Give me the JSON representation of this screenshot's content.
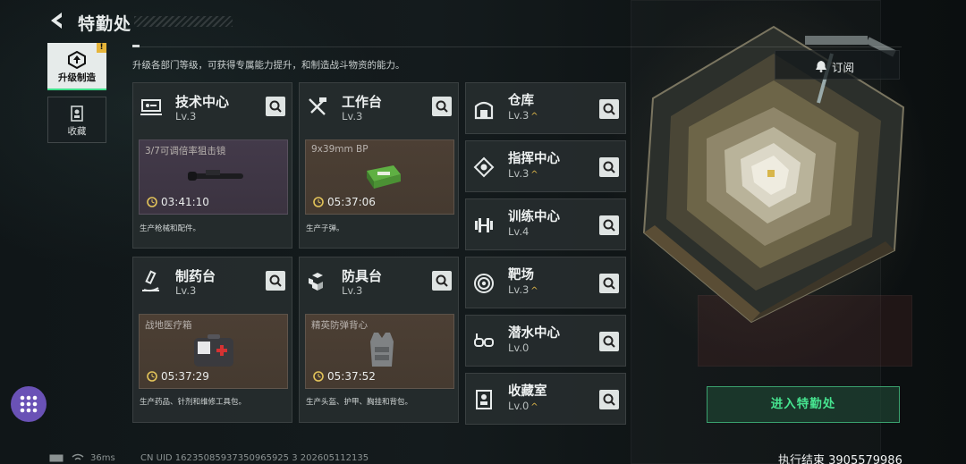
{
  "header": {
    "title": "特勤处"
  },
  "description": "升级各部门等级，可获得专属能力提升，和制造战斗物资的能力。",
  "nav": [
    {
      "label": "升级制造",
      "icon": "upgrade-icon",
      "badge": "!"
    },
    {
      "label": "收藏",
      "icon": "collection-icon"
    }
  ],
  "cards": [
    {
      "name": "技术中心",
      "level": "Lv.3",
      "icon": "tech-center-icon",
      "slot_title": "3/7可调倍率狙击镜",
      "timer": "03:41:10",
      "footer": "生产枪械和配件。",
      "item_icon": "scope-icon"
    },
    {
      "name": "工作台",
      "level": "Lv.3",
      "icon": "workbench-icon",
      "slot_title": "9x39mm BP",
      "timer": "05:37:06",
      "footer": "生产子弹。",
      "item_icon": "ammo-box-icon"
    },
    {
      "name": "制药台",
      "level": "Lv.3",
      "icon": "pharmacy-icon",
      "slot_title": "战地医疗箱",
      "timer": "05:37:29",
      "footer": "生产药品、针剂和维修工具包。",
      "item_icon": "medkit-icon"
    },
    {
      "name": "防具台",
      "level": "Lv.3",
      "icon": "armor-bench-icon",
      "slot_title": "精英防弹背心",
      "timer": "05:37:52",
      "footer": "生产头盔、护甲、胸挂和背包。",
      "item_icon": "vest-icon"
    }
  ],
  "departments": [
    {
      "name": "仓库",
      "level": "Lv.3",
      "upgradable": true,
      "icon": "warehouse-icon"
    },
    {
      "name": "指挥中心",
      "level": "Lv.3",
      "upgradable": true,
      "icon": "command-center-icon"
    },
    {
      "name": "训练中心",
      "level": "Lv.4",
      "upgradable": false,
      "icon": "dumbbell-icon"
    },
    {
      "name": "靶场",
      "level": "Lv.3",
      "upgradable": true,
      "icon": "target-icon"
    },
    {
      "name": "潜水中心",
      "level": "Lv.0",
      "upgradable": false,
      "icon": "diving-mask-icon"
    },
    {
      "name": "收藏室",
      "level": "Lv.0",
      "upgradable": true,
      "icon": "collection-room-icon"
    }
  ],
  "upgrade_mark": "^",
  "subscribe_label": "订阅",
  "enter_label": "进入特勤处",
  "status": {
    "ping": "36ms",
    "uid": "CN UID 16235085937350965925 3 202605112135"
  },
  "exec_text": "执行结束 3905579986",
  "colors": {
    "accent_green": "#46e38f",
    "upgrade_gold": "#e3b94a",
    "menu_purple": "#6a52b6"
  }
}
